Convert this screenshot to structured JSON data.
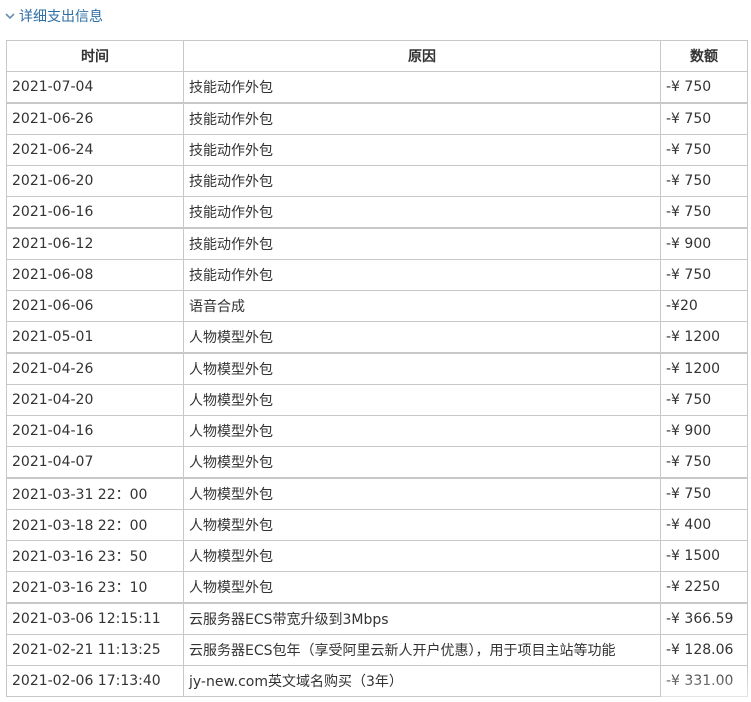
{
  "section": {
    "title": "详细支出信息"
  },
  "table": {
    "headers": {
      "time": "时间",
      "reason": "原因",
      "amount": "数额"
    },
    "rows": [
      {
        "time": "2021-07-04",
        "reason": "技能动作外包",
        "amount": "-¥ 750"
      },
      {
        "time": "2021-06-26",
        "reason": "技能动作外包",
        "amount": "-¥ 750"
      },
      {
        "time": "2021-06-24",
        "reason": "技能动作外包",
        "amount": "-¥ 750"
      },
      {
        "time": "2021-06-20",
        "reason": "技能动作外包",
        "amount": "-¥ 750"
      },
      {
        "time": "2021-06-16",
        "reason": "技能动作外包",
        "amount": "-¥ 750"
      },
      {
        "time": "2021-06-12",
        "reason": "技能动作外包",
        "amount": "-¥ 900"
      },
      {
        "time": "2021-06-08",
        "reason": "技能动作外包",
        "amount": "-¥ 750"
      },
      {
        "time": "2021-06-06",
        "reason": "语音合成",
        "amount": "-¥20"
      },
      {
        "time": "2021-05-01",
        "reason": "人物模型外包",
        "amount": "-¥ 1200"
      },
      {
        "time": "2021-04-26",
        "reason": "人物模型外包",
        "amount": "-¥ 1200"
      },
      {
        "time": "2021-04-20",
        "reason": "人物模型外包",
        "amount": "-¥ 750"
      },
      {
        "time": "2021-04-16",
        "reason": "人物模型外包",
        "amount": "-¥ 900"
      },
      {
        "time": "2021-04-07",
        "reason": "人物模型外包",
        "amount": "-¥ 750"
      },
      {
        "time": "2021-03-31 22：00",
        "reason": "人物模型外包",
        "amount": "-¥ 750"
      },
      {
        "time": "2021-03-18 22：00",
        "reason": "人物模型外包",
        "amount": "-¥ 400"
      },
      {
        "time": "2021-03-16 23：50",
        "reason": "人物模型外包",
        "amount": "-¥ 1500"
      },
      {
        "time": "2021-03-16 23：10",
        "reason": "人物模型外包",
        "amount": "-¥ 2250"
      },
      {
        "time": "2021-03-06 12:15:11",
        "reason": "云服务器ECS带宽升级到3Mbps",
        "amount": "-¥ 366.59"
      },
      {
        "time": "2021-02-21 11:13:25",
        "reason": "云服务器ECS包年（享受阿里云新人开户优惠），用于项目主站等功能",
        "amount": "-¥ 128.06"
      },
      {
        "time": "2021-02-06 17:13:40",
        "reason": "jy-new.com英文域名购买（3年）",
        "amount": "-¥ 331.00"
      }
    ]
  }
}
